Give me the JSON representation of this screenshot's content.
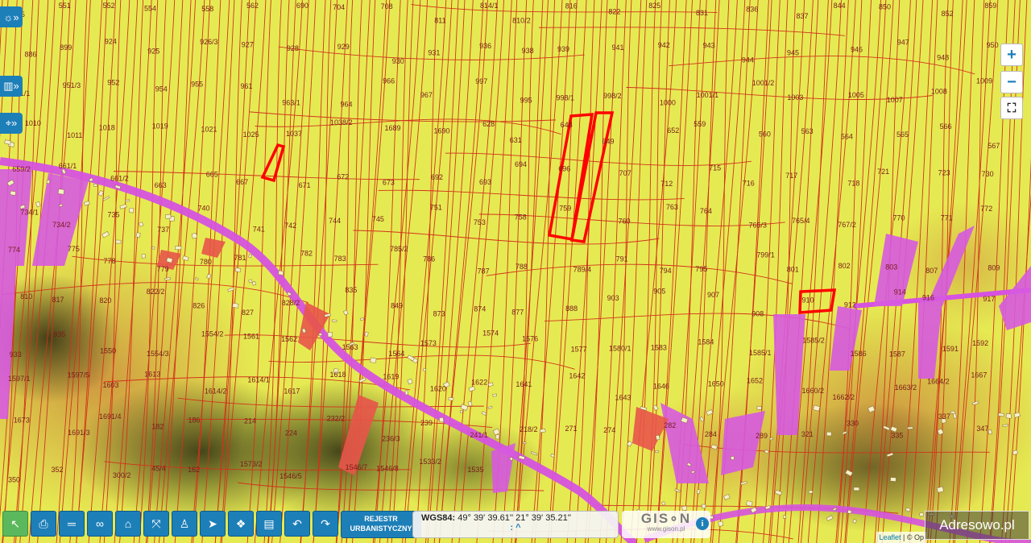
{
  "map": {
    "parcels": [
      "625",
      "551",
      "552",
      "554",
      "558",
      "562",
      "690",
      "704",
      "708",
      "811",
      "814/1",
      "810/2",
      "816",
      "822",
      "825",
      "831",
      "836",
      "837",
      "844",
      "850",
      "852",
      "859",
      "886",
      "899",
      "924",
      "925",
      "926/3",
      "927",
      "928",
      "929",
      "930",
      "931",
      "936",
      "938",
      "939",
      "941",
      "942",
      "943",
      "944",
      "945",
      "946",
      "947",
      "948",
      "950",
      "951/1",
      "951/3",
      "952",
      "954",
      "955",
      "961",
      "963/1",
      "964",
      "966",
      "967",
      "997",
      "995",
      "998/1",
      "998/2",
      "1000",
      "1001/1",
      "1001/2",
      "1003",
      "1005",
      "1007",
      "1008",
      "1009",
      "1010",
      "1011",
      "1018",
      "1019",
      "1021",
      "1025",
      "1037",
      "1038/2",
      "1689",
      "1690",
      "628",
      "631",
      "648",
      "649",
      "652",
      "559",
      "560",
      "563",
      "564",
      "565",
      "566",
      "567",
      "659/2",
      "661/1",
      "661/2",
      "663",
      "665",
      "667",
      "671",
      "672",
      "673",
      "692",
      "693",
      "694",
      "696",
      "707",
      "712",
      "715",
      "716",
      "717",
      "718",
      "721",
      "723",
      "730",
      "734/1",
      "734/2",
      "735",
      "737",
      "740",
      "741",
      "742",
      "744",
      "745",
      "751",
      "753",
      "758",
      "759",
      "760",
      "763",
      "764",
      "765/3",
      "765/4",
      "767/2",
      "770",
      "771",
      "772",
      "774",
      "775",
      "778",
      "779",
      "780",
      "781",
      "782",
      "783",
      "785/2",
      "786",
      "787",
      "788",
      "789/4",
      "791",
      "794",
      "795",
      "799/1",
      "801",
      "802",
      "803",
      "807",
      "809",
      "810",
      "817",
      "820",
      "822/2",
      "826",
      "827",
      "828/2",
      "835",
      "849",
      "873",
      "874",
      "877",
      "888",
      "903",
      "905",
      "907",
      "908",
      "910",
      "912",
      "914",
      "916",
      "917",
      "933",
      "935",
      "1550",
      "1554/3",
      "1554/2",
      "1561",
      "1562",
      "1563",
      "1564",
      "1573",
      "1574",
      "1576",
      "1577",
      "1580/1",
      "1583",
      "1584",
      "1585/1",
      "1585/2",
      "1586",
      "1587",
      "1591",
      "1592",
      "1597/1",
      "1597/5",
      "1603",
      "1613",
      "1614/2",
      "1614/1",
      "1617",
      "1618",
      "1619",
      "1620",
      "1622",
      "1641",
      "1642",
      "1643",
      "1646",
      "1650",
      "1652",
      "1660/2",
      "1662/2",
      "1663/2",
      "1664/2",
      "1667",
      "1673",
      "1691/3",
      "1691/4",
      "182",
      "186",
      "214",
      "224",
      "232/2",
      "236/3",
      "239",
      "241/1",
      "218/2",
      "271",
      "274",
      "282",
      "284",
      "289",
      "321",
      "330",
      "335",
      "337",
      "347",
      "350",
      "352",
      "300/2",
      "45/4",
      "162",
      "1573/2",
      "1546/5",
      "1546/7",
      "1546/8",
      "1533/2",
      "1535"
    ],
    "highlighted_parcels": [
      "877",
      "967"
    ]
  },
  "left_controls": [
    "layers-toggle",
    "map-toggle",
    "location-toggle"
  ],
  "zoom": {
    "in": "+",
    "out": "−"
  },
  "toolbar": {
    "tools": [
      "select-tool",
      "print-tool",
      "measure-distance-tool",
      "link-tool",
      "measure-area-tool",
      "split-tool",
      "person-tool",
      "navigate-tool",
      "bookmark-tool",
      "map-layers-tool",
      "undo-tool",
      "redo-tool"
    ],
    "rejestr_line1": "REJESTR",
    "rejestr_line2": "URBANISTYCZNY"
  },
  "coords": {
    "label": "WGS84:",
    "value": "49° 39' 39.61'' 21° 39' 35.21''",
    "toggle": ": ^"
  },
  "brand": {
    "logo": "GIS∘N",
    "url": "www.gison.pl"
  },
  "attribution": {
    "leaflet": "Leaflet",
    "rest": " | © Op"
  },
  "watermark": "Adresowo.pl"
}
